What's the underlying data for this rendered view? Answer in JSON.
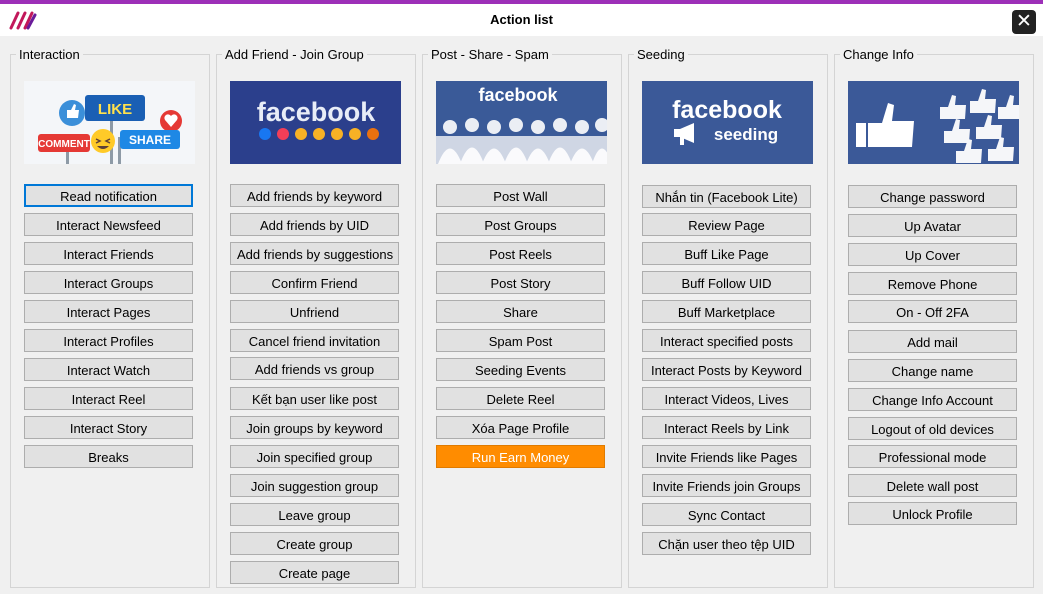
{
  "window": {
    "title": "Action list",
    "close_glyph": "✕"
  },
  "colors": {
    "accent": "#ff8c00",
    "titlebar_border": "#9d2fb8",
    "focus": "#0078d7"
  },
  "banners": {
    "interaction": {
      "like": "LIKE",
      "comment": "COMMENT",
      "share": "SHARE"
    },
    "add_friend": {
      "brand": "facebook"
    },
    "post": {
      "brand": "facebook"
    },
    "seeding": {
      "brand": "facebook",
      "sub": "seeding"
    }
  },
  "groups": [
    {
      "title": "Interaction",
      "buttons": [
        "Read notification",
        "Interact Newsfeed",
        "Interact Friends",
        "Interact Groups",
        "Interact Pages",
        "Interact Profiles",
        "Interact Watch",
        "Interact Reel",
        "Interact Story",
        "Breaks"
      ]
    },
    {
      "title": "Add Friend - Join Group",
      "buttons": [
        "Add friends by keyword",
        "Add friends by UID",
        "Add friends by suggestions",
        "Confirm Friend",
        "Unfriend",
        "Cancel friend invitation",
        "Add friends vs group",
        "Kết bạn user like post",
        "Join groups by keyword",
        "Join specified group",
        "Join suggestion group",
        "Leave group",
        "Create group",
        "Create page"
      ]
    },
    {
      "title": "Post - Share - Spam",
      "buttons": [
        "Post Wall",
        "Post Groups",
        "Post Reels",
        "Post Story",
        "Share",
        "Spam Post",
        "Seeding Events",
        "Delete Reel",
        "Xóa Page Profile",
        "Run Earn Money"
      ]
    },
    {
      "title": "Seeding",
      "buttons": [
        "Nhắn tin (Facebook Lite)",
        "Review Page",
        "Buff Like Page",
        "Buff Follow UID",
        "Buff Marketplace",
        "Interact specified posts",
        "Interact Posts by Keyword",
        "Interact Videos, Lives",
        "Interact Reels by Link",
        "Invite Friends like Pages",
        "Invite Friends join Groups",
        "Sync Contact",
        "Chặn user theo tệp UID"
      ]
    },
    {
      "title": "Change Info",
      "buttons": [
        "Change password",
        "Up Avatar",
        "Up Cover",
        "Remove Phone",
        "On - Off 2FA",
        "Add mail",
        "Change name",
        "Change Info Account",
        "Logout of old devices",
        "Professional mode",
        "Delete wall post",
        "Unlock Profile"
      ]
    }
  ]
}
